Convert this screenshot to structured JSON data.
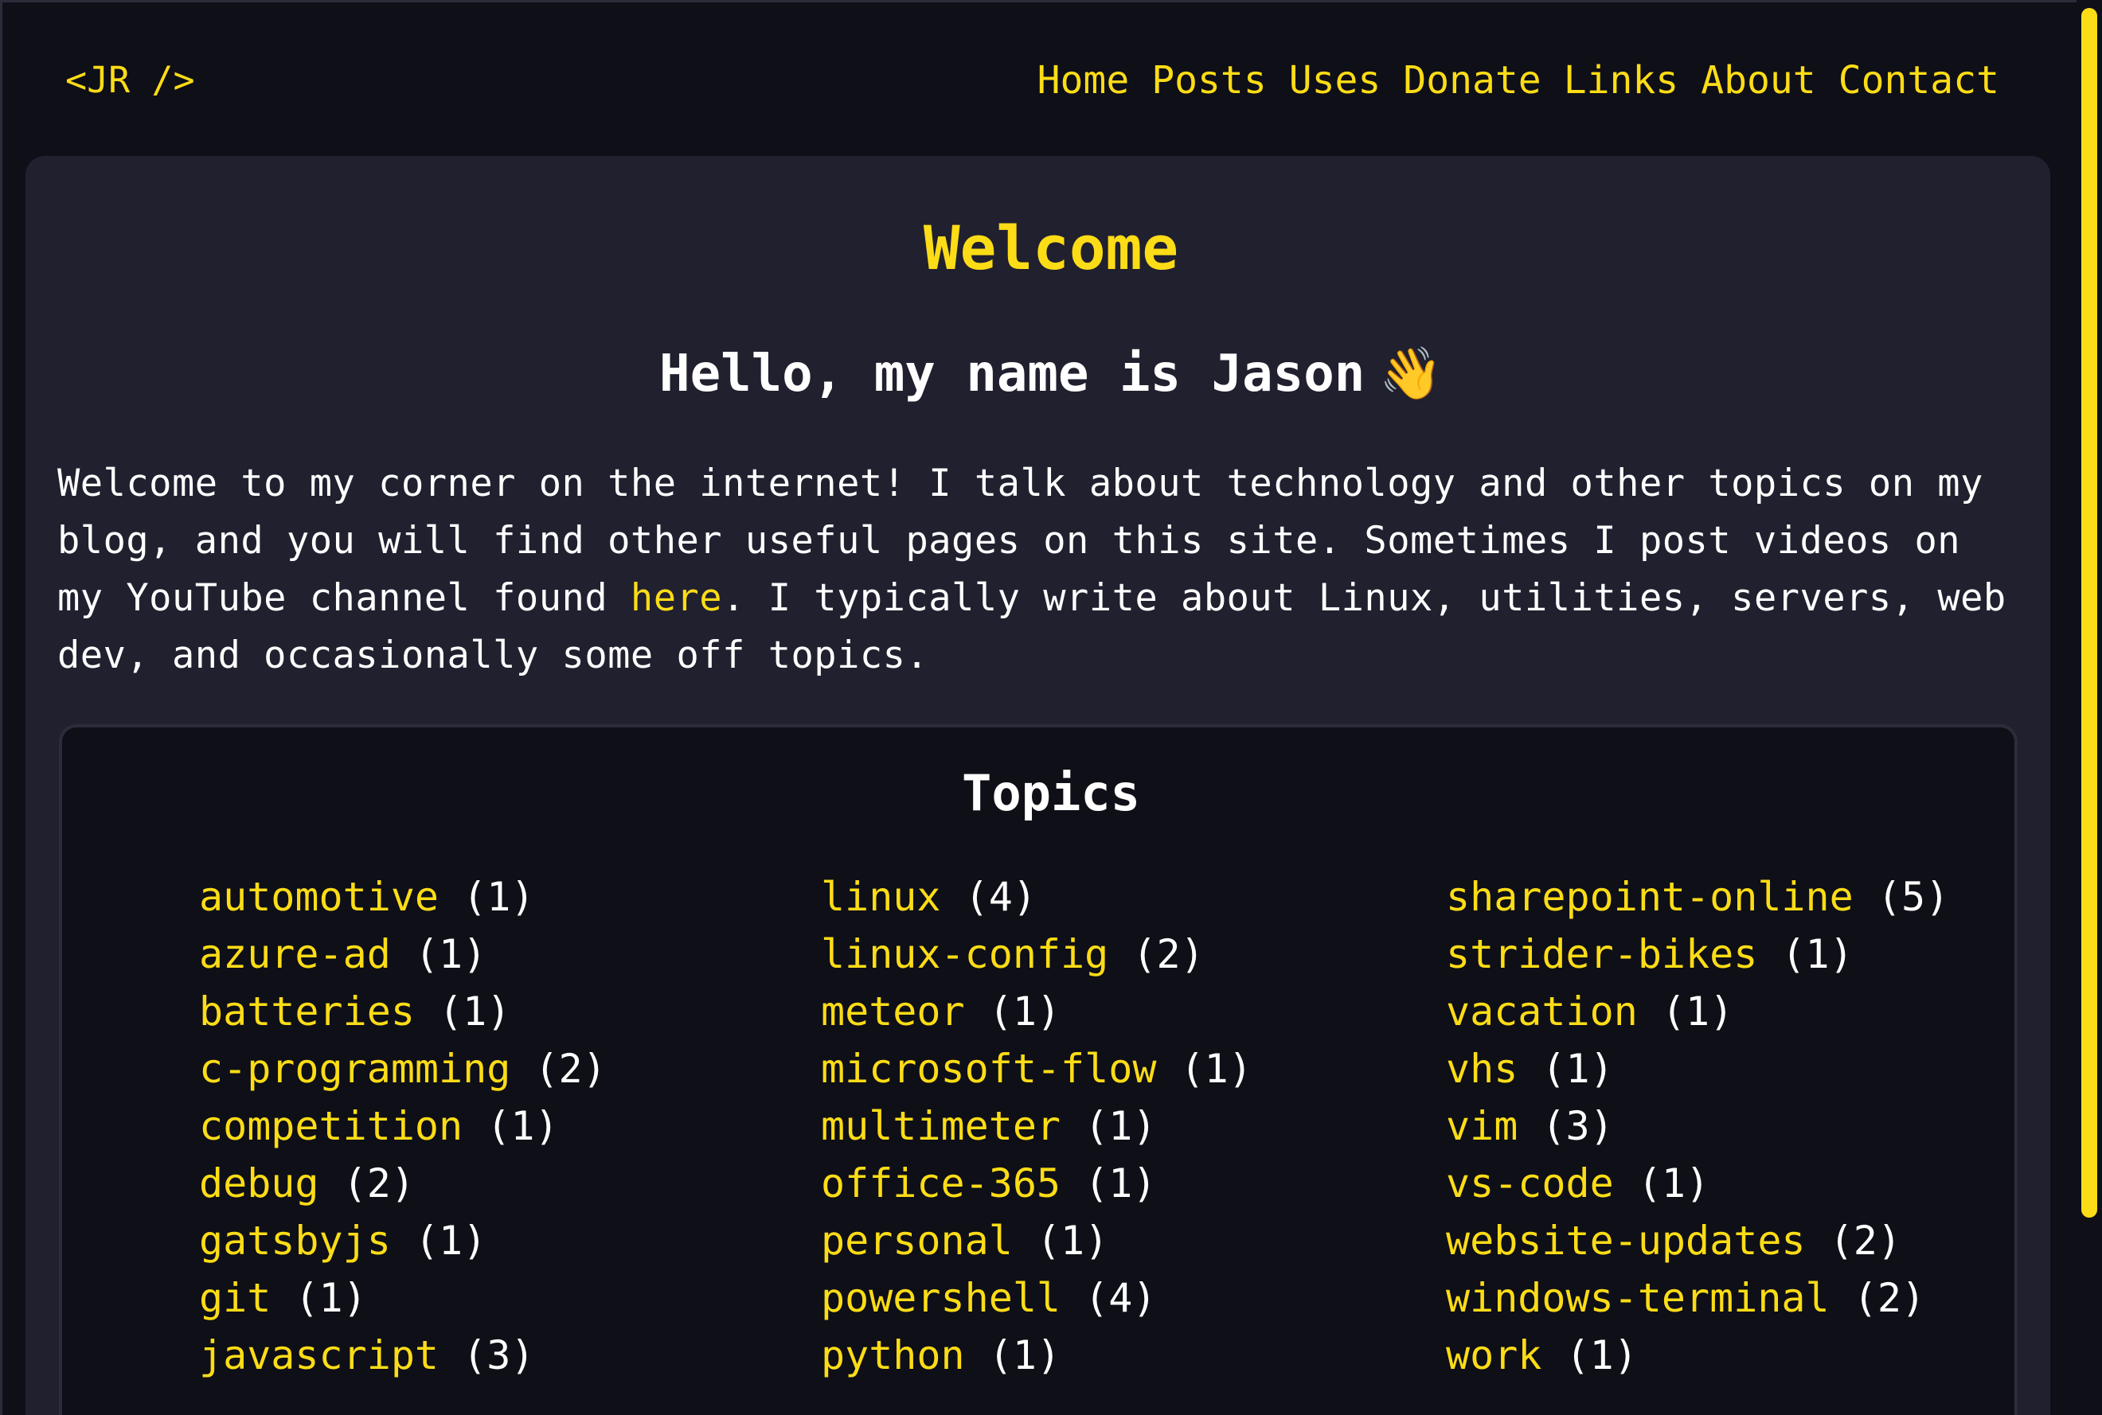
{
  "header": {
    "logo": "<JR />",
    "nav": [
      "Home",
      "Posts",
      "Uses",
      "Donate",
      "Links",
      "About",
      "Contact"
    ]
  },
  "main": {
    "title": "Welcome",
    "greeting": "Hello, my name is Jason",
    "greeting_emoji": "👋",
    "intro": {
      "line1": "Welcome to my corner on the internet! I talk about technology and other topics on my",
      "line2": "blog, and you will find other useful pages on this site. Sometimes I post videos on",
      "line3_before": "my YouTube channel found ",
      "line3_link": "here",
      "line3_after": ". I typically write about Linux, utilities, servers, web",
      "line4": "dev, and occasionally some off topics."
    }
  },
  "topics": {
    "title": "Topics",
    "columns": [
      [
        {
          "name": "automotive",
          "count": "(1)"
        },
        {
          "name": "azure-ad",
          "count": "(1)"
        },
        {
          "name": "batteries",
          "count": "(1)"
        },
        {
          "name": "c-programming",
          "count": "(2)"
        },
        {
          "name": "competition",
          "count": "(1)"
        },
        {
          "name": "debug",
          "count": "(2)"
        },
        {
          "name": "gatsbyjs",
          "count": "(1)"
        },
        {
          "name": "git",
          "count": "(1)"
        },
        {
          "name": "javascript",
          "count": "(3)"
        }
      ],
      [
        {
          "name": "linux",
          "count": "(4)"
        },
        {
          "name": "linux-config",
          "count": "(2)"
        },
        {
          "name": "meteor",
          "count": "(1)"
        },
        {
          "name": "microsoft-flow",
          "count": "(1)"
        },
        {
          "name": "multimeter",
          "count": "(1)"
        },
        {
          "name": "office-365",
          "count": "(1)"
        },
        {
          "name": "personal",
          "count": "(1)"
        },
        {
          "name": "powershell",
          "count": "(4)"
        },
        {
          "name": "python",
          "count": "(1)"
        }
      ],
      [
        {
          "name": "sharepoint-online",
          "count": "(5)"
        },
        {
          "name": "strider-bikes",
          "count": "(1)"
        },
        {
          "name": "vacation",
          "count": "(1)"
        },
        {
          "name": "vhs",
          "count": "(1)"
        },
        {
          "name": "vim",
          "count": "(3)"
        },
        {
          "name": "vs-code",
          "count": "(1)"
        },
        {
          "name": "website-updates",
          "count": "(2)"
        },
        {
          "name": "windows-terminal",
          "count": "(2)"
        },
        {
          "name": "work",
          "count": "(1)"
        }
      ]
    ]
  },
  "colors": {
    "accent": "#fcdc16",
    "page_bg": "#0e0f17",
    "card_bg": "#20202f",
    "text": "#ffffff"
  }
}
